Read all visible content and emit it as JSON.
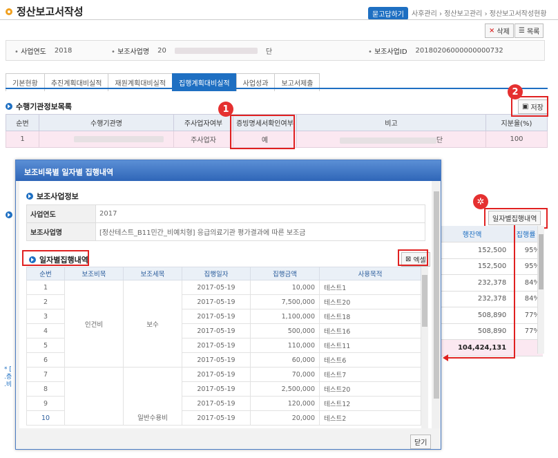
{
  "header": {
    "title": "정산보고서작성",
    "help_label": "묻고답하기",
    "breadcrumb": [
      "사후관리",
      "정산보고관리",
      "정산보고서작성현황"
    ],
    "delete_label": "삭제",
    "list_label": "목록"
  },
  "info_bar": {
    "year_label": "사업연도",
    "year_value": "2018",
    "project_label": "보조사업명",
    "project_value": "20",
    "project_suffix": "단",
    "id_label": "보조사업ID",
    "id_value": "20180206000000000732"
  },
  "tabs": [
    {
      "label": "기본현황",
      "active": false
    },
    {
      "label": "추진계획대비실적",
      "active": false
    },
    {
      "label": "재원계획대비실적",
      "active": false
    },
    {
      "label": "집행계획대비실적",
      "active": true
    },
    {
      "label": "사업성과",
      "active": false
    },
    {
      "label": "보고서제출",
      "active": false
    }
  ],
  "section1": {
    "title": "수행기관정보목록",
    "save_label": "저장",
    "columns": [
      "순번",
      "수행기관명",
      "주사업자여부",
      "증빙명세서확인여부",
      "비고",
      "지분율(%)"
    ],
    "row": {
      "no": "1",
      "org": "",
      "main": "주사업자",
      "confirm": "예",
      "note": "단",
      "share": "100"
    }
  },
  "annotations": {
    "badge1": "1",
    "badge2": "2"
  },
  "bg_table": {
    "daily_btn": "일자별집행내역",
    "columns": [
      "행잔액",
      "집행률"
    ],
    "rows": [
      {
        "amount": "152,500",
        "rate": "95%"
      },
      {
        "amount": "152,500",
        "rate": "95%"
      },
      {
        "amount": "232,378",
        "rate": "84%"
      },
      {
        "amount": "232,378",
        "rate": "84%"
      },
      {
        "amount": "508,890",
        "rate": "77%"
      },
      {
        "amount": "508,890",
        "rate": "77%"
      }
    ],
    "total": "104,424,131",
    "left_fragments": [
      "* [",
      ".층",
      ".비"
    ]
  },
  "popup": {
    "title": "보조비목별 일자별 집행내역",
    "info_heading": "보조사업정보",
    "year_label": "사업연도",
    "year_value": "2017",
    "project_label": "보조사업명",
    "project_value": "[정산테스트_B11민간_비예치형] 응급의료기관 평가결과에 따른 보조금",
    "daily_heading": "일자별집행내역",
    "excel_label": "엑셀",
    "columns": [
      "순번",
      "보조비목",
      "보조세목",
      "집행일자",
      "집행금액",
      "사용목적"
    ],
    "group1": {
      "item": "인건비",
      "sub": "보수"
    },
    "group2": {
      "sub": "일반수용비"
    },
    "rows": [
      {
        "no": "1",
        "date": "2017-05-19",
        "amount": "10,000",
        "purpose": "테스트1"
      },
      {
        "no": "2",
        "date": "2017-05-19",
        "amount": "7,500,000",
        "purpose": "테스트20"
      },
      {
        "no": "3",
        "date": "2017-05-19",
        "amount": "1,100,000",
        "purpose": "테스트18"
      },
      {
        "no": "4",
        "date": "2017-05-19",
        "amount": "500,000",
        "purpose": "테스트16"
      },
      {
        "no": "5",
        "date": "2017-05-19",
        "amount": "110,000",
        "purpose": "테스트11"
      },
      {
        "no": "6",
        "date": "2017-05-19",
        "amount": "60,000",
        "purpose": "테스트6"
      },
      {
        "no": "7",
        "date": "2017-05-19",
        "amount": "70,000",
        "purpose": "테스트7"
      },
      {
        "no": "8",
        "date": "2017-05-19",
        "amount": "2,500,000",
        "purpose": "테스트20"
      },
      {
        "no": "9",
        "date": "2017-05-19",
        "amount": "120,000",
        "purpose": "테스트12"
      },
      {
        "no": "10",
        "date": "2017-05-19",
        "amount": "20,000",
        "purpose": "테스트2"
      }
    ],
    "close_label": "닫기"
  },
  "colors": {
    "accent": "#1e6fc2",
    "annotation": "#e02020",
    "highlight_row": "#fbe8f1"
  }
}
